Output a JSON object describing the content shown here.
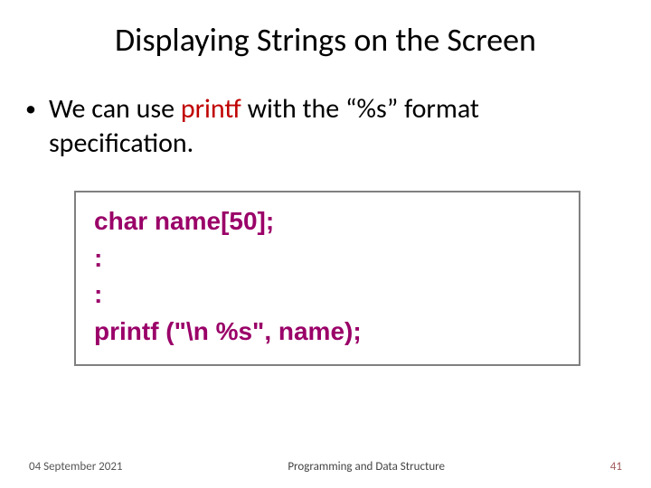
{
  "title": "Displaying Strings on the Screen",
  "bullet": {
    "pre": "We can use ",
    "printf": "printf",
    "post": " with the “%s” format specification."
  },
  "code": {
    "l1": "char name[50];",
    "l2": ":",
    "l3": ":",
    "l4": "printf (\"\\n %s\", name);"
  },
  "footer": {
    "date": "04 September 2021",
    "course": "Programming and Data Structure",
    "page": "41"
  }
}
